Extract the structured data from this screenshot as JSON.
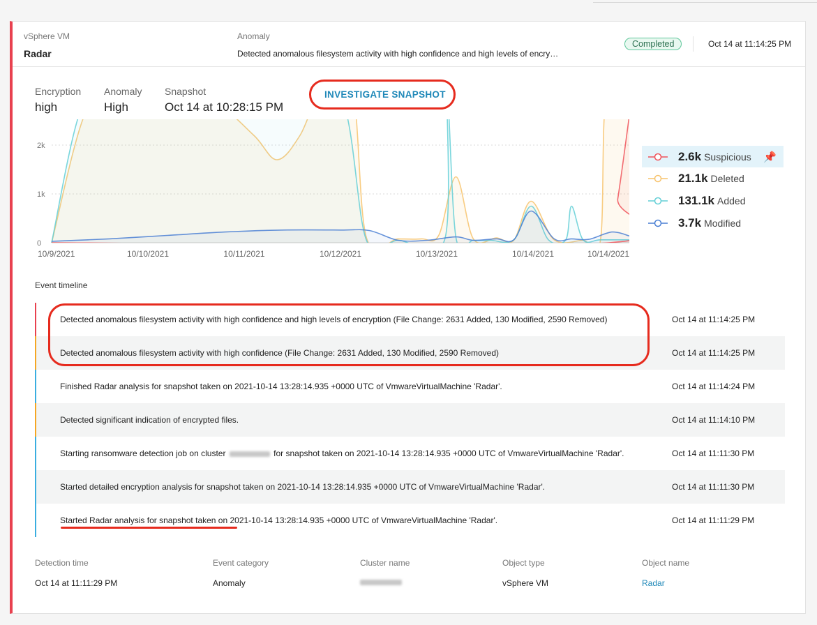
{
  "header": {
    "object_type_label": "vSphere VM",
    "object_name": "Radar",
    "anomaly_label": "Anomaly",
    "anomaly_desc": "Detected anomalous filesystem activity with high confidence and high levels of encry…",
    "status": "Completed",
    "timestamp": "Oct 14 at 11:14:25 PM"
  },
  "metrics": [
    {
      "label": "Encryption",
      "value": "high"
    },
    {
      "label": "Anomaly",
      "value": "High"
    },
    {
      "label": "Snapshot",
      "value": "Oct 14 at 10:28:15 PM"
    }
  ],
  "investigate_label": "INVESTIGATE SNAPSHOT",
  "chart_data": {
    "type": "line",
    "x_tick_labels": [
      "10/9/2021",
      "10/10/2021",
      "10/11/2021",
      "10/12/2021",
      "10/13/2021",
      "10/14/2021",
      "10/14/2021"
    ],
    "y_tick_labels": [
      "0",
      "1k",
      "2k"
    ],
    "ylim": [
      0,
      2500
    ],
    "grid": true,
    "legend_position": "right",
    "series": [
      {
        "name": "Suspicious",
        "total": "2.6k",
        "color": "#f0525a",
        "x": [
          0,
          0.965,
          0.98,
          1.0
        ],
        "y": [
          0,
          0,
          900,
          2600
        ]
      },
      {
        "name": "Deleted",
        "total": "21.1k",
        "color": "#f7c36c",
        "x": [
          0,
          0.06,
          0.12,
          0.2,
          0.28,
          0.35,
          0.39,
          0.43,
          0.47,
          0.52,
          0.545,
          0.6,
          0.64,
          0.67,
          0.7,
          0.73,
          0.77,
          0.8,
          0.83,
          0.87,
          0.92,
          0.95,
          0.96,
          1.0
        ],
        "y": [
          0,
          2700,
          2900,
          3100,
          2900,
          2200,
          1700,
          2200,
          3200,
          3200,
          100,
          80,
          80,
          150,
          1350,
          80,
          100,
          50,
          850,
          60,
          50,
          50,
          3000,
          3000
        ]
      },
      {
        "name": "Added",
        "total": "131.1k",
        "color": "#63cfd6",
        "x": [
          0,
          0.05,
          0.1,
          0.2,
          0.3,
          0.4,
          0.5,
          0.545,
          0.6,
          0.68,
          0.685,
          0.7,
          0.73,
          0.76,
          0.8,
          0.83,
          0.86,
          0.89,
          0.9,
          0.92,
          0.95,
          1.0
        ],
        "y": [
          0,
          2700,
          2900,
          3000,
          3000,
          3000,
          3000,
          50,
          50,
          50,
          3000,
          100,
          50,
          50,
          60,
          750,
          60,
          60,
          750,
          60,
          60,
          60
        ]
      },
      {
        "name": "Modified",
        "total": "3.7k",
        "color": "#4a7fd4",
        "x": [
          0,
          0.1,
          0.2,
          0.3,
          0.4,
          0.5,
          0.55,
          0.6,
          0.65,
          0.7,
          0.73,
          0.77,
          0.8,
          0.83,
          0.87,
          0.9,
          0.93,
          0.97,
          1.0
        ],
        "y": [
          30,
          80,
          150,
          220,
          260,
          260,
          250,
          50,
          50,
          120,
          50,
          80,
          60,
          650,
          80,
          80,
          70,
          220,
          140
        ]
      }
    ]
  },
  "timeline": {
    "title": "Event timeline",
    "events": [
      {
        "text": "Detected anomalous filesystem activity with high confidence and high levels of encryption (File Change: 2631 Added, 130 Modified, 2590 Removed)",
        "time": "Oct 14 at 11:14:25 PM",
        "level": "red"
      },
      {
        "text": "Detected anomalous filesystem activity with high confidence (File Change: 2631 Added, 130 Modified, 2590 Removed)",
        "time": "Oct 14 at 11:14:25 PM",
        "level": "orange"
      },
      {
        "text": "Finished Radar analysis for snapshot taken on 2021-10-14 13:28:14.935 +0000 UTC of VmwareVirtualMachine 'Radar'.",
        "time": "Oct 14 at 11:14:24 PM",
        "level": "blue"
      },
      {
        "text": "Detected significant indication of encrypted files.",
        "time": "Oct 14 at 11:14:10 PM",
        "level": "orange"
      },
      {
        "text_before": "Starting ransomware detection job on cluster",
        "text_after": "for snapshot taken on 2021-10-14 13:28:14.935 +0000 UTC of VmwareVirtualMachine 'Radar'.",
        "time": "Oct 14 at 11:11:30 PM",
        "level": "blue"
      },
      {
        "text": "Started detailed encryption analysis for snapshot taken on 2021-10-14 13:28:14.935 +0000 UTC of VmwareVirtualMachine 'Radar'.",
        "time": "Oct 14 at 11:11:30 PM",
        "level": "blue"
      },
      {
        "text": "Started Radar analysis for snapshot taken on 2021-10-14 13:28:14.935 +0000 UTC of VmwareVirtualMachine 'Radar'.",
        "time": "Oct 14 at 11:11:29 PM",
        "level": "blue"
      }
    ]
  },
  "footer": {
    "detection_time_label": "Detection time",
    "detection_time": "Oct 14 at 11:11:29 PM",
    "event_category_label": "Event category",
    "event_category": "Anomaly",
    "cluster_name_label": "Cluster name",
    "object_type_label": "Object type",
    "object_type": "vSphere VM",
    "object_name_label": "Object name",
    "object_name": "Radar"
  }
}
